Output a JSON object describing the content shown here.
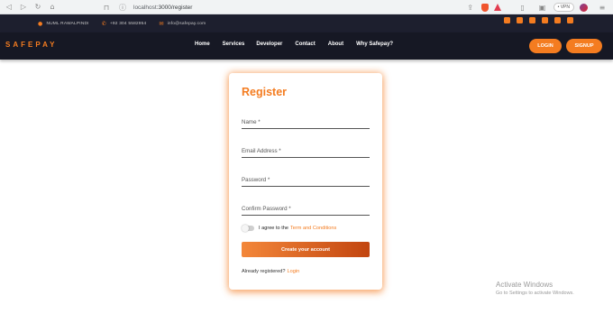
{
  "browser": {
    "url_host": "localhost",
    "url_path": ":3000/register",
    "vpn_label": "• VPN"
  },
  "info_bar": {
    "location": "NUML RAWALPINDI",
    "phone": "+92 304 5582954",
    "email": "info@safepay.com"
  },
  "nav": {
    "logo": "SAFEPAY",
    "items": [
      "Home",
      "Services",
      "Developer",
      "Contact",
      "About",
      "Why Safepay?"
    ],
    "login": "LOGIN",
    "signup": "SIGNUP"
  },
  "form": {
    "title": "Register",
    "name_label": "Name *",
    "email_label": "Email Address *",
    "password_label": "Password *",
    "confirm_label": "Confirm Password *",
    "agree_text": "I agree to the",
    "terms_link": "Term and Conditions",
    "submit": "Create your account",
    "already": "Already registered?",
    "login_link": "Login"
  },
  "watermark": {
    "title": "Activate Windows",
    "subtitle": "Go to Settings to activate Windows."
  },
  "colors": {
    "accent": "#f47c20",
    "nav_bg": "#161824",
    "info_bg": "#1d1f2e"
  }
}
